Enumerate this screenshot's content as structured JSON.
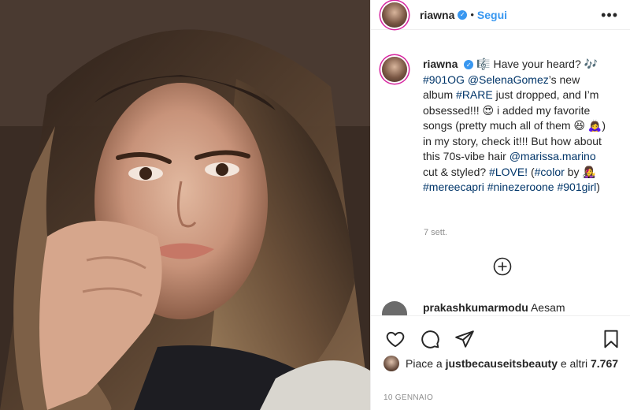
{
  "post": {
    "username": "riawna",
    "follow_label": "Segui",
    "dot": "•",
    "more_label": "•••"
  },
  "caption": {
    "username": "riawna",
    "segments": [
      {
        "text": "🎼 Have your heard? 🎶 ",
        "link": false
      },
      {
        "text": "#901OG",
        "link": true
      },
      {
        "text": " ",
        "link": false
      },
      {
        "text": "@SelenaGomez",
        "link": true
      },
      {
        "text": "’s new album ",
        "link": false
      },
      {
        "text": "#RARE",
        "link": true
      },
      {
        "text": " just dropped, and I’m obsessed!!! 😍 i added my favorite songs (pretty much all of them 😆 🙇‍♀️) in my story, check it!!! But how about this 70s-vibe hair ",
        "link": false
      },
      {
        "text": "@marissa.marino",
        "link": true
      },
      {
        "text": " cut & styled? ",
        "link": false
      },
      {
        "text": "#LOVE!",
        "link": true
      },
      {
        "text": " (",
        "link": false
      },
      {
        "text": "#color",
        "link": true
      },
      {
        "text": " by 👩‍🎤 ",
        "link": false
      },
      {
        "text": "#mereecapri",
        "link": true
      },
      {
        "text": " ",
        "link": false
      },
      {
        "text": "#ninezeroone",
        "link": true
      },
      {
        "text": " ",
        "link": false
      },
      {
        "text": "#901girl",
        "link": true
      },
      {
        "text": ")",
        "link": false
      }
    ],
    "time": "7 sett."
  },
  "reply": {
    "username": "prakashkumarmodu",
    "text": "Aesam"
  },
  "likes": {
    "prefix": "Piace a ",
    "user": "justbecauseitsbeauty",
    "middle": " e altri ",
    "count": "7.767"
  },
  "date": "10 GENNAIO",
  "icons": {
    "like": "heart-icon",
    "comment": "comment-icon",
    "share": "share-icon",
    "save": "bookmark-icon",
    "add": "plus-circle-icon",
    "more": "more-icon"
  },
  "colors": {
    "link": "#003569",
    "accent": "#3897f0",
    "muted": "#8e8e8e"
  }
}
